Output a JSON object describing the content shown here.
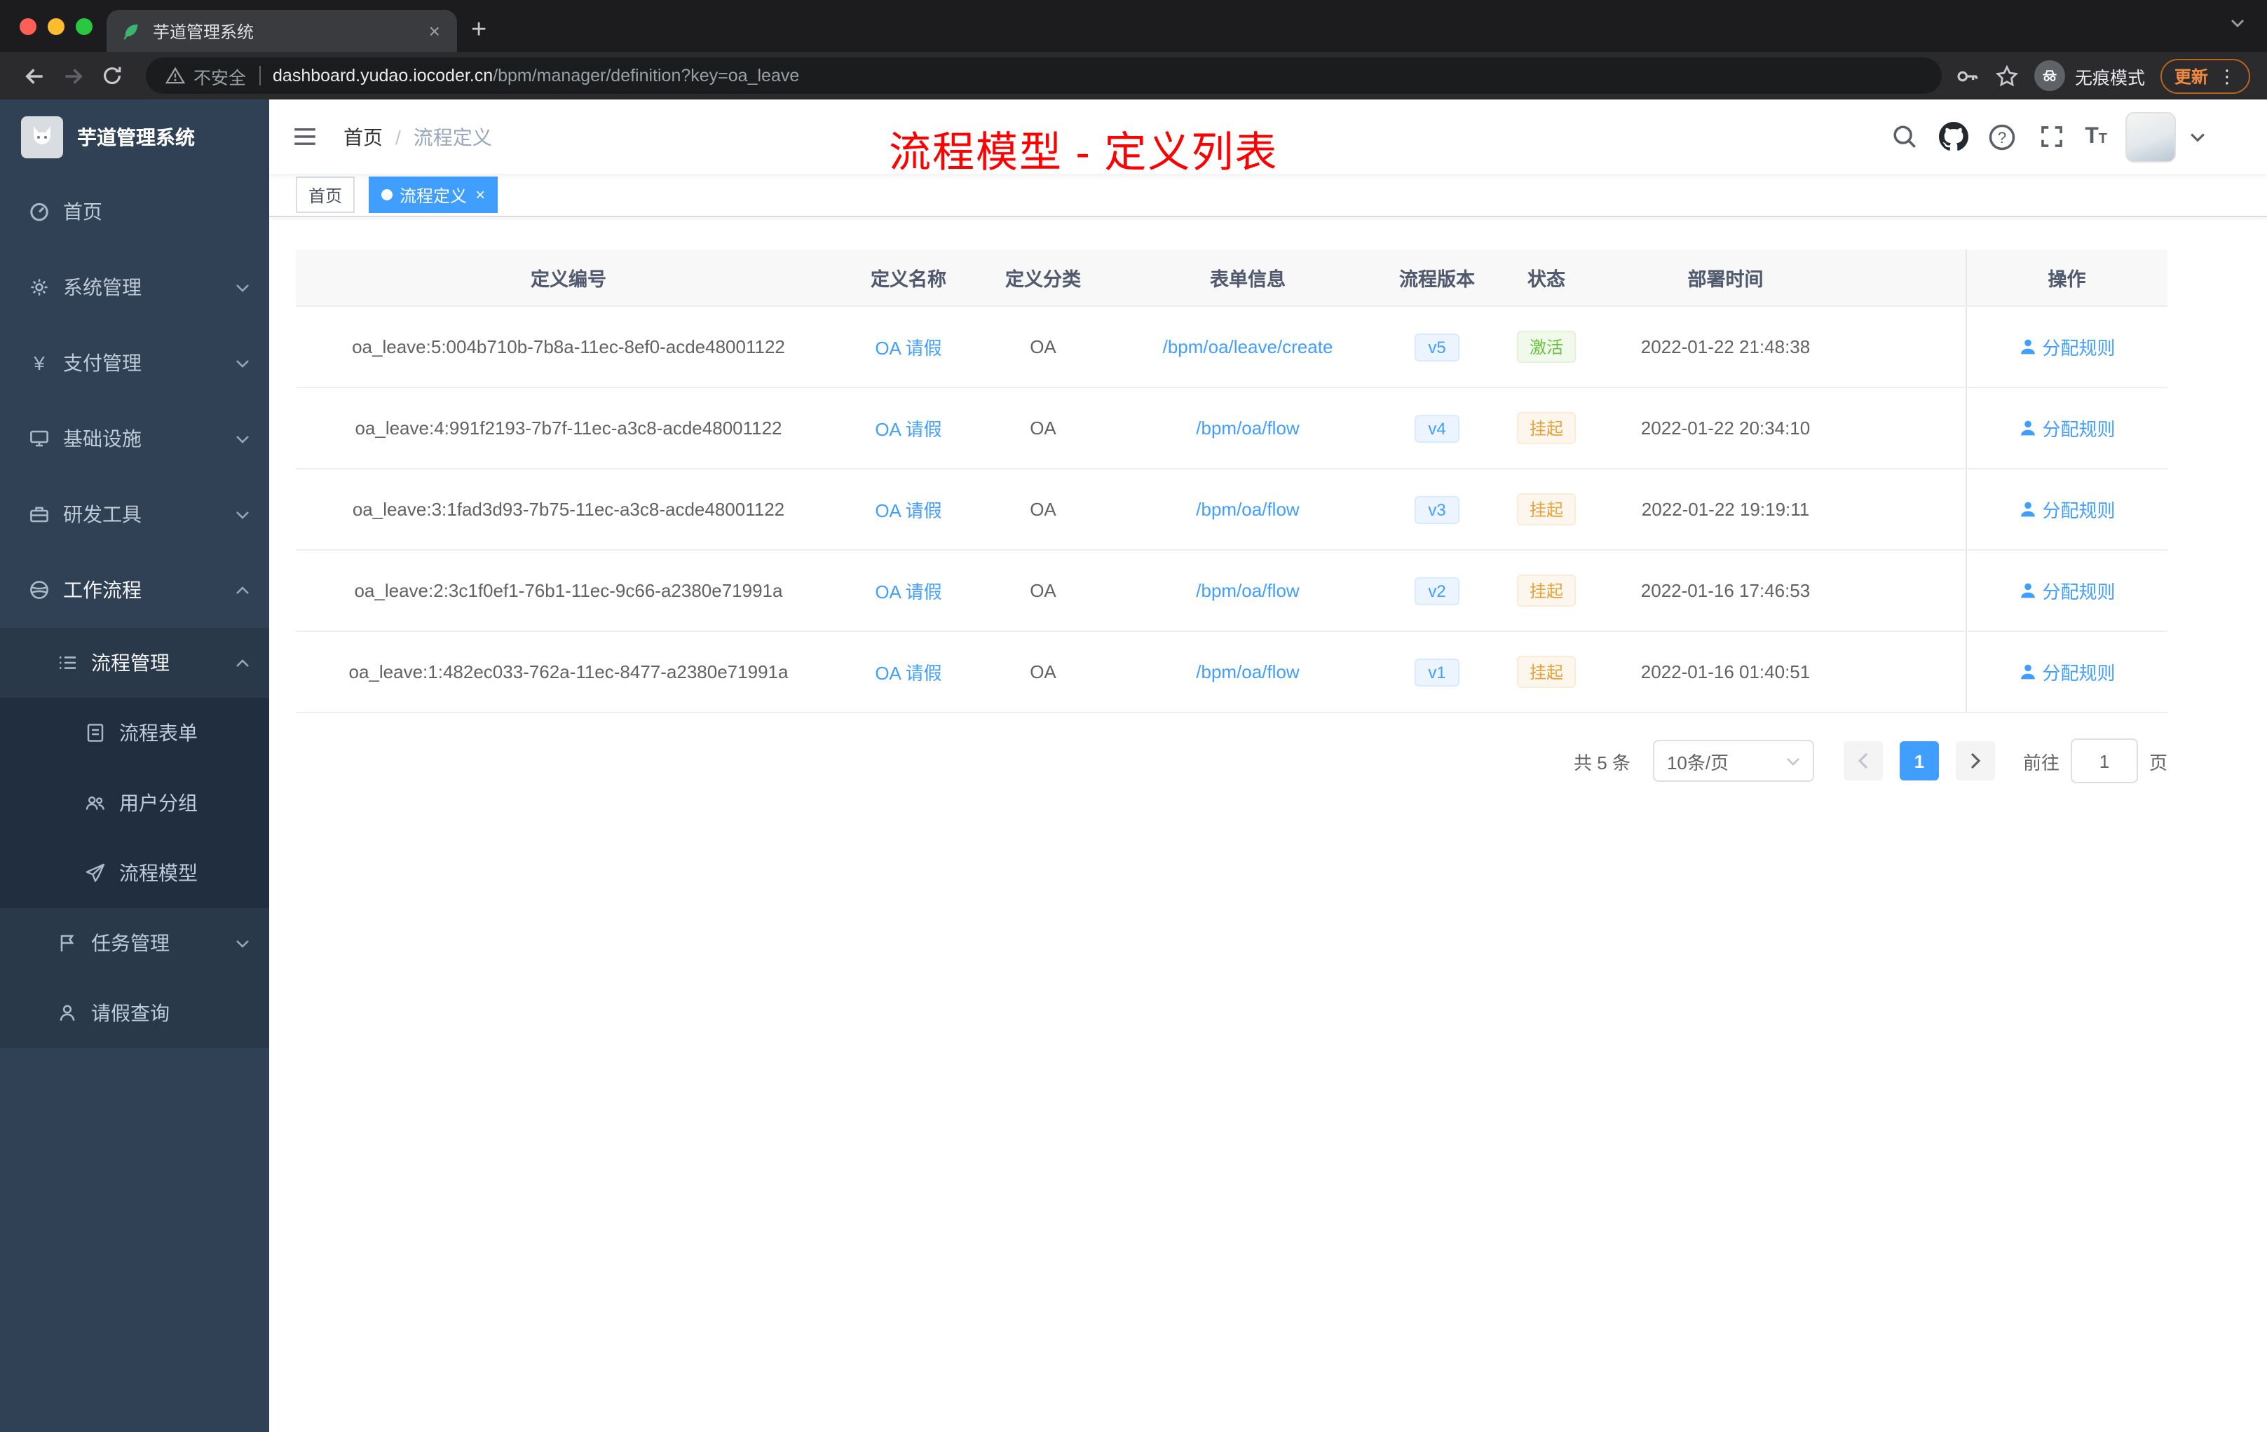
{
  "browser": {
    "tab_title": "芋道管理系统",
    "security_label": "不安全",
    "url_host": "dashboard.yudao.iocoder.cn",
    "url_path": "/bpm/manager/definition?key=oa_leave",
    "incognito_label": "无痕模式",
    "update_label": "更新"
  },
  "glyphs": {
    "close": "×",
    "plus": "+",
    "menu_dots": "⋮"
  },
  "sidebar": {
    "logo_title": "芋道管理系统",
    "items": [
      {
        "label": "首页"
      },
      {
        "label": "系统管理"
      },
      {
        "label": "支付管理"
      },
      {
        "label": "基础设施"
      },
      {
        "label": "研发工具"
      },
      {
        "label": "工作流程"
      },
      {
        "label": "流程管理"
      },
      {
        "label": "流程表单"
      },
      {
        "label": "用户分组"
      },
      {
        "label": "流程模型"
      },
      {
        "label": "任务管理"
      },
      {
        "label": "请假查询"
      }
    ]
  },
  "navbar": {
    "breadcrumb_home": "首页",
    "breadcrumb_sep": "/",
    "breadcrumb_current": "流程定义",
    "annotation": "流程模型 - 定义列表"
  },
  "tags": {
    "home": "首页",
    "active": "流程定义"
  },
  "table": {
    "columns": [
      "定义编号",
      "定义名称",
      "定义分类",
      "表单信息",
      "流程版本",
      "状态",
      "部署时间",
      "操作"
    ],
    "rows": [
      {
        "id": "oa_leave:5:004b710b-7b8a-11ec-8ef0-acde48001122",
        "name": "OA 请假",
        "category": "OA",
        "form": "/bpm/oa/leave/create",
        "version": "v5",
        "status": "激活",
        "status_type": "success",
        "time": "2022-01-22 21:48:38",
        "action": "分配规则"
      },
      {
        "id": "oa_leave:4:991f2193-7b7f-11ec-a3c8-acde48001122",
        "name": "OA 请假",
        "category": "OA",
        "form": "/bpm/oa/flow",
        "version": "v4",
        "status": "挂起",
        "status_type": "warning",
        "time": "2022-01-22 20:34:10",
        "action": "分配规则"
      },
      {
        "id": "oa_leave:3:1fad3d93-7b75-11ec-a3c8-acde48001122",
        "name": "OA 请假",
        "category": "OA",
        "form": "/bpm/oa/flow",
        "version": "v3",
        "status": "挂起",
        "status_type": "warning",
        "time": "2022-01-22 19:19:11",
        "action": "分配规则"
      },
      {
        "id": "oa_leave:2:3c1f0ef1-76b1-11ec-9c66-a2380e71991a",
        "name": "OA 请假",
        "category": "OA",
        "form": "/bpm/oa/flow",
        "version": "v2",
        "status": "挂起",
        "status_type": "warning",
        "time": "2022-01-16 17:46:53",
        "action": "分配规则"
      },
      {
        "id": "oa_leave:1:482ec033-762a-11ec-8477-a2380e71991a",
        "name": "OA 请假",
        "category": "OA",
        "form": "/bpm/oa/flow",
        "version": "v1",
        "status": "挂起",
        "status_type": "warning",
        "time": "2022-01-16 01:40:51",
        "action": "分配规则"
      }
    ]
  },
  "pagination": {
    "total": "共 5 条",
    "size": "10条/页",
    "page": "1",
    "goto": "前往",
    "goto_value": "1",
    "unit": "页"
  },
  "colors": {
    "accent": "#409eff",
    "success": "#67c23a",
    "warning": "#e6a23c",
    "annotation": "#fe0000",
    "sidebar_bg": "#304156",
    "tag_active": "#409eff"
  }
}
